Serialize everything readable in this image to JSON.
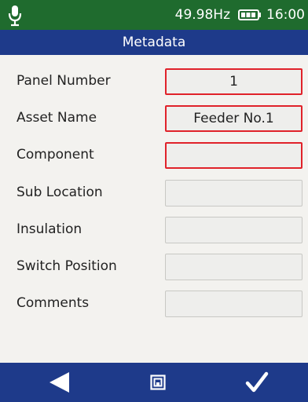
{
  "status_bar": {
    "icon_left": "microphone-icon",
    "frequency": "49.98Hz",
    "battery_icon": "battery-icon",
    "time": "16:00"
  },
  "title": "Metadata",
  "fields": [
    {
      "label": "Panel Number",
      "value": "1",
      "selected": true
    },
    {
      "label": "Asset Name",
      "value": "Feeder No.1",
      "selected": true
    },
    {
      "label": "Component",
      "value": "",
      "selected": true
    },
    {
      "label": "Sub Location",
      "value": "",
      "selected": false
    },
    {
      "label": "Insulation",
      "value": "",
      "selected": false
    },
    {
      "label": "Switch Position",
      "value": "",
      "selected": false
    },
    {
      "label": "Comments",
      "value": "",
      "selected": false
    }
  ],
  "bottom_bar": {
    "left_icon": "back-arrow-icon",
    "center_icon": "save-icon",
    "right_icon": "checkmark-icon"
  },
  "colors": {
    "status_bar": "#1f6b2e",
    "title_bar": "#1e3a8a",
    "bottom_bar": "#1e3a8a",
    "selected_border": "#e0222a",
    "background": "#f3f2ef"
  }
}
